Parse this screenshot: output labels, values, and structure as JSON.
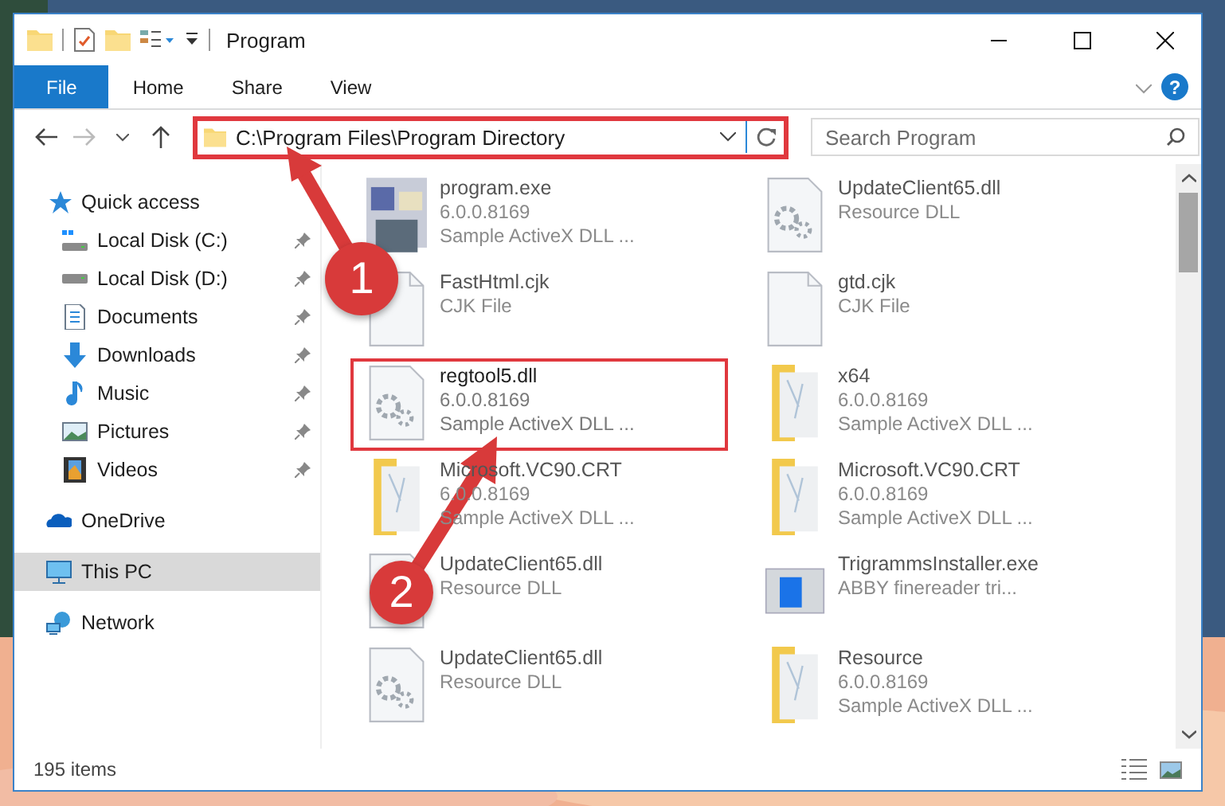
{
  "window": {
    "title": "Program"
  },
  "ribbon": {
    "tabs": [
      {
        "label": "File",
        "selected": true
      },
      {
        "label": "Home",
        "selected": false
      },
      {
        "label": "Share",
        "selected": false
      },
      {
        "label": "View",
        "selected": false
      }
    ],
    "help": "?"
  },
  "address": {
    "path": "C:\\Program Files\\Program Directory",
    "highlighted": true
  },
  "search": {
    "placeholder": "Search Program"
  },
  "nav": [
    {
      "label": "Quick access",
      "kind": "star",
      "selected": false,
      "children": [
        {
          "label": "Local Disk (C:)",
          "kind": "system-drive",
          "pinned": true,
          "selected": false
        },
        {
          "label": "Local Disk (D:)",
          "kind": "drive",
          "pinned": true,
          "selected": false
        },
        {
          "label": "Documents",
          "kind": "documents",
          "pinned": true,
          "selected": false
        },
        {
          "label": "Downloads",
          "kind": "downloads",
          "pinned": true,
          "selected": false
        },
        {
          "label": "Music",
          "kind": "music",
          "pinned": true,
          "selected": false
        },
        {
          "label": "Pictures",
          "kind": "pictures",
          "pinned": true,
          "selected": false
        },
        {
          "label": "Videos",
          "kind": "videos",
          "pinned": true,
          "selected": false
        }
      ]
    },
    {
      "label": "OneDrive",
      "kind": "cloud",
      "selected": false
    },
    {
      "label": "This PC",
      "kind": "pc",
      "selected": true
    },
    {
      "label": "Network",
      "kind": "network",
      "selected": false
    }
  ],
  "files": [
    {
      "name": "program.exe",
      "lines": [
        "6.0.0.8169",
        "Sample ActiveX DLL ..."
      ],
      "kind": "exe",
      "highlighted": false,
      "blurred": true
    },
    {
      "name": "UpdateClient65.dll",
      "lines": [
        "Resource DLL"
      ],
      "kind": "dll",
      "highlighted": false,
      "blurred": true
    },
    {
      "name": "FastHtml.cjk",
      "lines": [
        "CJK File"
      ],
      "kind": "file",
      "highlighted": false,
      "blurred": true
    },
    {
      "name": "gtd.cjk",
      "lines": [
        "CJK File"
      ],
      "kind": "file",
      "highlighted": false,
      "blurred": true
    },
    {
      "name": "regtool5.dll",
      "lines": [
        "6.0.0.8169",
        "Sample ActiveX DLL ..."
      ],
      "kind": "dll",
      "highlighted": true,
      "blurred": false
    },
    {
      "name": "x64",
      "lines": [
        "6.0.0.8169",
        "Sample ActiveX DLL ..."
      ],
      "kind": "folder",
      "highlighted": false,
      "blurred": true
    },
    {
      "name": "Microsoft.VC90.CRT",
      "lines": [
        "6.0.0.8169",
        "Sample ActiveX DLL ..."
      ],
      "kind": "folder",
      "highlighted": false,
      "blurred": true
    },
    {
      "name": "Microsoft.VC90.CRT",
      "lines": [
        "6.0.0.8169",
        "Sample ActiveX DLL ..."
      ],
      "kind": "folder",
      "highlighted": false,
      "blurred": true
    },
    {
      "name": "UpdateClient65.dll",
      "lines": [
        "Resource DLL"
      ],
      "kind": "dll",
      "highlighted": false,
      "blurred": true
    },
    {
      "name": "TrigrammsInstaller.exe",
      "lines": [
        "ABBY finereader tri..."
      ],
      "kind": "app",
      "highlighted": false,
      "blurred": true
    },
    {
      "name": "UpdateClient65.dll",
      "lines": [
        "Resource DLL"
      ],
      "kind": "dll",
      "highlighted": false,
      "blurred": true
    },
    {
      "name": "Resource",
      "lines": [
        "6.0.0.8169",
        "Sample ActiveX DLL ..."
      ],
      "kind": "folder",
      "highlighted": false,
      "blurred": true
    }
  ],
  "status_bar": {
    "count": "195 items"
  },
  "annotations": [
    {
      "label": "1"
    },
    {
      "label": "2"
    }
  ]
}
